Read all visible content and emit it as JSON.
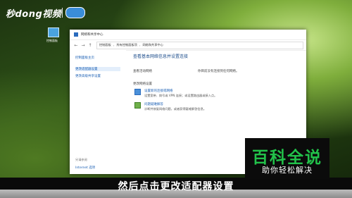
{
  "watermark": {
    "logo": "秒dong视频"
  },
  "desktop": {
    "icon_label": "控制面板"
  },
  "window": {
    "title": "网络和共享中心",
    "nav": {
      "back": "←",
      "forward": "→",
      "up": "↑"
    },
    "breadcrumbs": [
      "控制面板",
      "所有控制面板项",
      "网络和共享中心"
    ],
    "sidebar": {
      "home": "控制面板主页",
      "links": [
        "更改适配器设置",
        "更改高级共享设置"
      ],
      "see_also": "另请参阅",
      "internet_options": "Internet 选项"
    },
    "main": {
      "heading": "查看基本网络信息并设置连接",
      "active_label": "查看活动网络",
      "active_value": "你目前没有连接到任何网络。",
      "change_label": "更改网络设置",
      "items": [
        {
          "title": "设置新的连接或网络",
          "desc": "设置宽带、拨号或 VPN 连接；或设置路由器或接入点。"
        },
        {
          "title": "问题疑难解答",
          "desc": "诊断并修复网络问题，或者获得疑难解答信息。"
        }
      ]
    }
  },
  "subtitle": "然后点击更改适配器设置",
  "brand_badge": {
    "title": "百科全说",
    "tagline": "助你轻松解决"
  }
}
